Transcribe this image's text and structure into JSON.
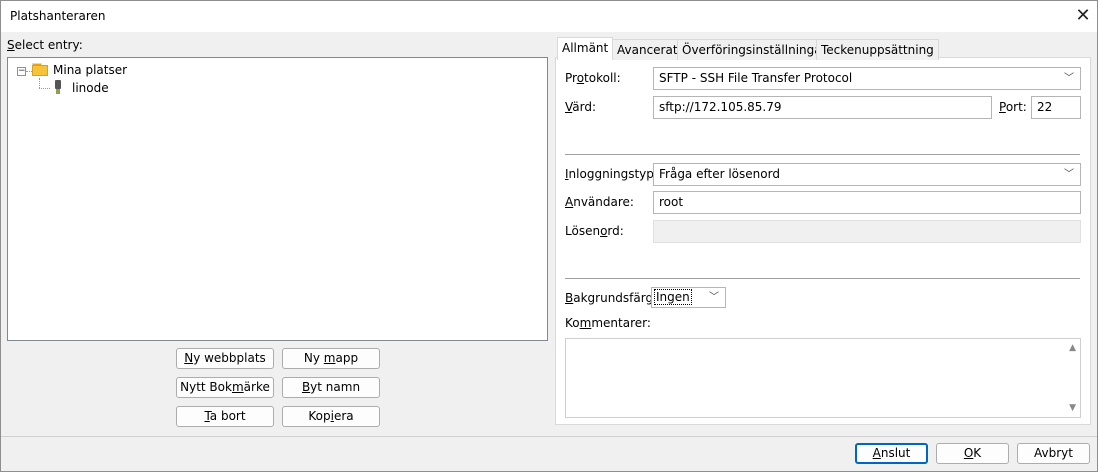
{
  "window": {
    "title": "Platshanteraren",
    "close_icon": "close-icon"
  },
  "left": {
    "select_label_u": "S",
    "select_label_rest": "elect entry:",
    "tree": {
      "root": {
        "label": "Mina platser",
        "icon": "folder-icon",
        "expanded": true
      },
      "children": [
        {
          "label": "linode",
          "icon": "server-icon"
        }
      ]
    },
    "buttons": {
      "new_site": [
        "Ny webbplats",
        "N",
        "y webbplats"
      ],
      "new_folder": [
        "Ny mapp",
        "Ny ",
        "m",
        "app"
      ],
      "new_bookmark": [
        "Nytt Bokmärke",
        "Nytt Bok",
        "m",
        "ärke"
      ],
      "rename": [
        "Byt namn",
        "B",
        "yt namn"
      ],
      "delete": [
        "Ta bort",
        "T",
        "a bort"
      ],
      "copy": [
        "Kopiera",
        "Kop",
        "i",
        "era"
      ]
    }
  },
  "tabs": [
    {
      "label": "Allmänt",
      "active": true
    },
    {
      "label": "Avancerat",
      "active": false
    },
    {
      "label": "Överföringsinställningar",
      "active": false
    },
    {
      "label": "Teckenuppsättning",
      "active": false
    }
  ],
  "general": {
    "protocol": {
      "label_a": "Pr",
      "label_u": "o",
      "label_b": "tokoll:",
      "value": "SFTP - SSH File Transfer Protocol"
    },
    "host": {
      "label_u": "V",
      "label_rest": "ärd:",
      "value": "sftp://172.105.85.79"
    },
    "port": {
      "label_u": "P",
      "label_rest": "ort:",
      "value": "22"
    },
    "logon_type": {
      "label_u": "I",
      "label_rest": "nloggningstyp:",
      "value": "Fråga efter lösenord"
    },
    "user": {
      "label_u": "A",
      "label_rest": "nvändare:",
      "value": "root"
    },
    "password": {
      "label_a": "Lösen",
      "label_u": "o",
      "label_b": "rd:",
      "value": ""
    },
    "background": {
      "label_u": "B",
      "label_rest": "akgrundsfärg:",
      "value": "Ingen"
    },
    "comments": {
      "label_a": "Ko",
      "label_u": "m",
      "label_b": "mentarer:",
      "value": ""
    }
  },
  "footer": {
    "connect": [
      "A",
      "nslut"
    ],
    "ok": [
      "O",
      "K"
    ],
    "cancel": [
      "Avbryt"
    ]
  }
}
